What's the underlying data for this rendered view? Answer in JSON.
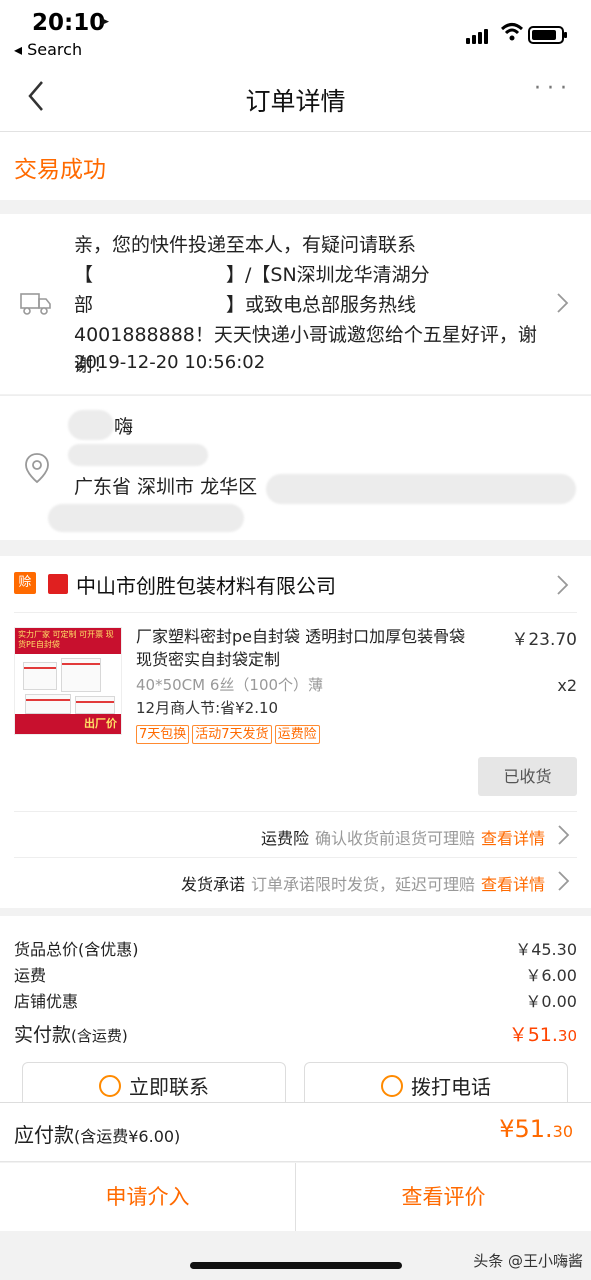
{
  "status_bar": {
    "time": "20:10",
    "back_app": "◂ Search"
  },
  "nav": {
    "title": "订单详情",
    "more": "···"
  },
  "order": {
    "status": "交易成功"
  },
  "logistics": {
    "message": "亲，您的快件投递至本人，有疑问请联系【　　　　　　　】/【SN深圳龙华清湖分部　　　　　　　】或致电总部服务热线4001888888！天天快递小哥诚邀您给个五星好评，谢谢！",
    "time": "2019-12-20 10:56:02"
  },
  "address": {
    "name": "嗨",
    "region": "广东省 深圳市 龙华区"
  },
  "shop": {
    "badge": "赊",
    "name": "中山市创胜包装材料有限公司"
  },
  "product": {
    "image_top_text": "实力厂家 可定制 可开票 现货PE自封袋",
    "image_bottom_text": "出厂价",
    "title": "厂家塑料密封pe自封袋 透明封口加厚包装骨袋 现货密实自封袋定制",
    "price": "￥23.70",
    "spec": "40*50CM 6丝（100个）薄",
    "qty": "x2",
    "promo": "12月商人节:省¥2.10",
    "tags": [
      "7天包换",
      "活动7天发货",
      "运费险"
    ]
  },
  "received_button": "已收货",
  "services": [
    {
      "label": "运费险",
      "desc": "确认收货前退货可理赔",
      "link": "查看详情"
    },
    {
      "label": "发货承诺",
      "desc": "订单承诺限时发货，延迟可理赔",
      "link": "查看详情"
    }
  ],
  "summary": {
    "rows": [
      {
        "label": "货品总价(含优惠)",
        "value": "￥45.30"
      },
      {
        "label": "运费",
        "value": "￥6.00"
      },
      {
        "label": "店铺优惠",
        "value": "￥0.00"
      }
    ],
    "paid_label": "实付款",
    "paid_label_note": "(含运费)",
    "paid_amount_main": "￥51.",
    "paid_amount_cents": "30"
  },
  "actions": {
    "contact": "立即联系",
    "call": "拨打电话"
  },
  "payable": {
    "label": "应付款",
    "note": "(含运费¥6.00)",
    "amount_main": "¥51.",
    "amount_cents": "30"
  },
  "bottom": {
    "intervene": "申请介入",
    "review": "查看评价"
  },
  "watermark": "头条 @王小嗨酱",
  "colors": {
    "accent": "#ff6a00",
    "price_red": "#ff4400"
  }
}
